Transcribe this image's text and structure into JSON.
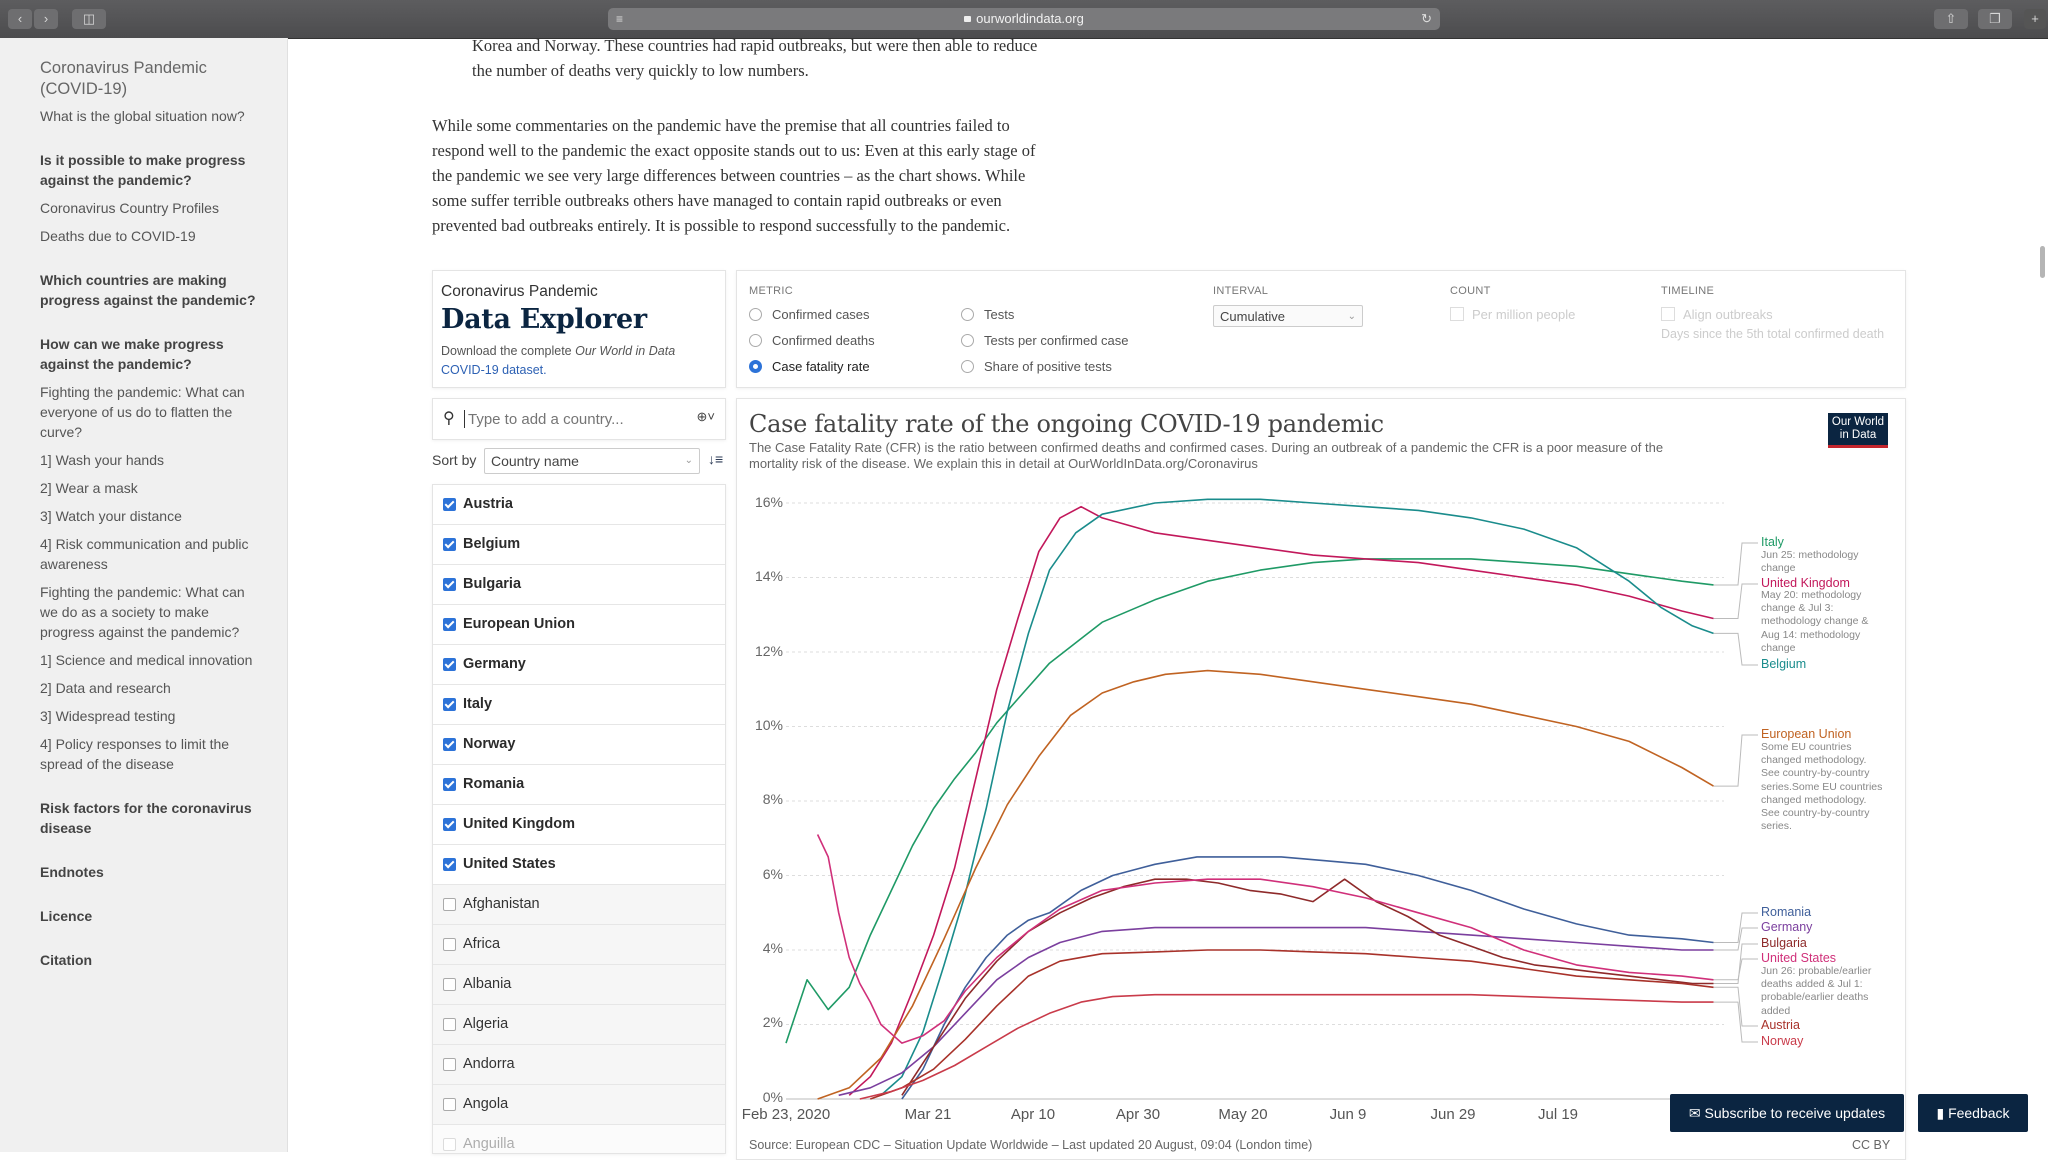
{
  "browser": {
    "url": "ourworldindata.org"
  },
  "sidebar": {
    "title": "Coronavirus Pandemic (COVID-19)",
    "items": [
      {
        "label": "What is the global situation now?",
        "bold": false
      },
      {
        "label": "Is it possible to make progress against the pandemic?",
        "bold": true
      },
      {
        "label": "Coronavirus Country Profiles",
        "bold": false
      },
      {
        "label": "Deaths due to COVID-19",
        "bold": false
      },
      {
        "label": "Which countries are making progress against the pandemic?",
        "bold": true
      },
      {
        "label": "How can we make progress against the pandemic?",
        "bold": true
      },
      {
        "label": "Fighting the pandemic: What can everyone of us do to flatten the curve?",
        "bold": false
      },
      {
        "label": "1] Wash your hands",
        "bold": false
      },
      {
        "label": "2] Wear a mask",
        "bold": false
      },
      {
        "label": "3] Watch your distance",
        "bold": false
      },
      {
        "label": "4] Risk communication and public awareness",
        "bold": false
      },
      {
        "label": "Fighting the pandemic: What can we do as a society to make progress against the pandemic?",
        "bold": false
      },
      {
        "label": "1] Science and medical innovation",
        "bold": false
      },
      {
        "label": "2] Data and research",
        "bold": false
      },
      {
        "label": "3] Widespread testing",
        "bold": false
      },
      {
        "label": "4] Policy responses to limit the spread of the disease",
        "bold": false
      },
      {
        "label": "Risk factors for the coronavirus disease",
        "bold": true
      },
      {
        "label": "Endnotes",
        "bold": true
      },
      {
        "label": "Licence",
        "bold": true
      },
      {
        "label": "Citation",
        "bold": true
      }
    ]
  },
  "article": {
    "intro_lines": [
      "Korea and Norway. These countries had rapid outbreaks, but were then able to reduce",
      "the number of deaths very quickly to low numbers."
    ],
    "paragraph_lines": [
      "While some commentaries on the pandemic have the premise that all countries failed to",
      "respond well to the pandemic the exact opposite stands out to us: Even at this early stage of",
      "the pandemic we see very large differences between countries – as the chart shows. While",
      "some suffer terrible outbreaks others have managed to contain rapid outbreaks or even",
      "prevented bad outbreaks entirely. It is possible to respond successfully to the pandemic."
    ]
  },
  "explorer": {
    "kicker": "Coronavirus Pandemic",
    "title": "Data Explorer",
    "download_prefix": "Download the complete ",
    "download_italic": "Our World in Data",
    "download_link": "COVID-19 dataset.",
    "search_placeholder": "Type to add a country...",
    "sort_by_label": "Sort by",
    "sort_value": "Country name",
    "countries": [
      {
        "name": "Austria",
        "selected": true
      },
      {
        "name": "Belgium",
        "selected": true
      },
      {
        "name": "Bulgaria",
        "selected": true
      },
      {
        "name": "European Union",
        "selected": true
      },
      {
        "name": "Germany",
        "selected": true
      },
      {
        "name": "Italy",
        "selected": true
      },
      {
        "name": "Norway",
        "selected": true
      },
      {
        "name": "Romania",
        "selected": true
      },
      {
        "name": "United Kingdom",
        "selected": true
      },
      {
        "name": "United States",
        "selected": true
      },
      {
        "name": "Afghanistan",
        "selected": false
      },
      {
        "name": "Africa",
        "selected": false
      },
      {
        "name": "Albania",
        "selected": false
      },
      {
        "name": "Algeria",
        "selected": false
      },
      {
        "name": "Andorra",
        "selected": false
      },
      {
        "name": "Angola",
        "selected": false
      },
      {
        "name": "Anguilla",
        "selected": false
      }
    ]
  },
  "controls": {
    "metric_heading": "METRIC",
    "metrics_col1": [
      "Confirmed cases",
      "Confirmed deaths",
      "Case fatality rate"
    ],
    "metrics_col2": [
      "Tests",
      "Tests per confirmed case",
      "Share of positive tests"
    ],
    "selected_metric": "Case fatality rate",
    "interval_heading": "INTERVAL",
    "interval_value": "Cumulative",
    "count_heading": "COUNT",
    "count_option": "Per million people",
    "timeline_heading": "TIMELINE",
    "timeline_option": "Align outbreaks",
    "timeline_note": "Days since the 5th total confirmed death"
  },
  "chart_header": {
    "logo_line1": "Our World",
    "logo_line2": "in Data",
    "source": "Source: European CDC – Situation Update Worldwide – Last updated 20 August, 09:04 (London time)",
    "license": "CC BY"
  },
  "chart_data": {
    "type": "line",
    "title": "Case fatality rate of the ongoing COVID-19 pandemic",
    "subtitle_lines": [
      "The Case Fatality Rate (CFR) is the ratio between confirmed deaths and confirmed cases. During an outbreak of a pandemic the CFR is a poor measure of the",
      "mortality risk of the disease. We explain this in detail at OurWorldInData.org/Coronavirus"
    ],
    "xlabel": "",
    "ylabel": "",
    "x_ticks": [
      "Feb 23, 2020",
      "Mar 21",
      "Apr 10",
      "Apr 30",
      "May 20",
      "Jun 9",
      "Jun 29",
      "Jul 19"
    ],
    "y_ticks": [
      "0%",
      "2%",
      "4%",
      "6%",
      "8%",
      "10%",
      "12%",
      "14%",
      "16%"
    ],
    "x_range_days": [
      0,
      178
    ],
    "ylim": [
      0,
      16
    ],
    "grid": true,
    "legend": "right-side labels",
    "series": [
      {
        "name": "Italy",
        "color": "#1f9a66",
        "x": [
          0,
          4,
          8,
          12,
          16,
          20,
          24,
          28,
          32,
          36,
          40,
          45,
          50,
          60,
          70,
          80,
          90,
          100,
          110,
          120,
          130,
          140,
          150,
          160,
          170,
          176
        ],
        "y": [
          1.5,
          3.2,
          2.4,
          3.0,
          4.4,
          5.6,
          6.8,
          7.8,
          8.6,
          9.3,
          10.1,
          10.9,
          11.7,
          12.8,
          13.4,
          13.9,
          14.2,
          14.4,
          14.5,
          14.5,
          14.5,
          14.4,
          14.3,
          14.1,
          13.9,
          13.8
        ]
      },
      {
        "name": "United Kingdom",
        "color": "#c2185b",
        "x": [
          12,
          16,
          20,
          24,
          28,
          32,
          36,
          40,
          44,
          48,
          52,
          56,
          60,
          70,
          80,
          90,
          100,
          110,
          120,
          130,
          140,
          150,
          160,
          170,
          176
        ],
        "y": [
          0.1,
          0.6,
          1.5,
          2.9,
          4.4,
          6.2,
          8.6,
          11.0,
          12.9,
          14.7,
          15.6,
          15.9,
          15.6,
          15.2,
          15.0,
          14.8,
          14.6,
          14.5,
          14.4,
          14.2,
          14.0,
          13.8,
          13.5,
          13.1,
          12.9
        ]
      },
      {
        "name": "Belgium",
        "color": "#1a8c8c",
        "x": [
          18,
          22,
          26,
          30,
          34,
          38,
          42,
          46,
          50,
          55,
          60,
          70,
          80,
          90,
          100,
          110,
          120,
          130,
          140,
          150,
          160,
          166,
          172,
          176
        ],
        "y": [
          0.1,
          0.6,
          1.8,
          3.6,
          5.5,
          7.8,
          10.4,
          12.5,
          14.2,
          15.2,
          15.7,
          16.0,
          16.1,
          16.1,
          16.0,
          15.9,
          15.8,
          15.6,
          15.3,
          14.8,
          13.9,
          13.2,
          12.7,
          12.5
        ]
      },
      {
        "name": "European Union",
        "color": "#c06322",
        "x": [
          6,
          12,
          18,
          24,
          30,
          36,
          42,
          48,
          54,
          60,
          66,
          72,
          80,
          90,
          100,
          110,
          120,
          130,
          140,
          150,
          160,
          170,
          176
        ],
        "y": [
          0.0,
          0.3,
          1.1,
          2.5,
          4.3,
          6.2,
          7.9,
          9.2,
          10.3,
          10.9,
          11.2,
          11.4,
          11.5,
          11.4,
          11.2,
          11.0,
          10.8,
          10.6,
          10.3,
          10.0,
          9.6,
          8.9,
          8.4
        ]
      },
      {
        "name": "Romania",
        "color": "#3f5f9a",
        "x": [
          22,
          26,
          30,
          34,
          38,
          42,
          46,
          50,
          56,
          62,
          70,
          78,
          86,
          94,
          102,
          110,
          120,
          130,
          140,
          150,
          160,
          170,
          176
        ],
        "y": [
          0.0,
          0.8,
          2.0,
          3.0,
          3.8,
          4.4,
          4.8,
          5.0,
          5.6,
          6.0,
          6.3,
          6.5,
          6.5,
          6.5,
          6.4,
          6.3,
          6.0,
          5.6,
          5.1,
          4.7,
          4.4,
          4.3,
          4.2
        ]
      },
      {
        "name": "Germany",
        "color": "#7b3f9e",
        "x": [
          10,
          16,
          22,
          28,
          34,
          40,
          46,
          52,
          60,
          70,
          80,
          90,
          100,
          110,
          120,
          130,
          140,
          150,
          160,
          170,
          176
        ],
        "y": [
          0.1,
          0.3,
          0.7,
          1.4,
          2.3,
          3.2,
          3.8,
          4.2,
          4.5,
          4.6,
          4.6,
          4.6,
          4.6,
          4.6,
          4.5,
          4.4,
          4.3,
          4.2,
          4.1,
          4.0,
          4.0
        ]
      },
      {
        "name": "Bulgaria",
        "color": "#8e2a2a",
        "x": [
          22,
          28,
          34,
          40,
          46,
          52,
          58,
          64,
          70,
          76,
          82,
          88,
          94,
          100,
          106,
          112,
          118,
          124,
          130,
          136,
          142,
          148,
          154,
          160,
          166,
          172,
          176
        ],
        "y": [
          0.1,
          1.4,
          2.7,
          3.7,
          4.5,
          5.0,
          5.4,
          5.7,
          5.9,
          5.9,
          5.8,
          5.6,
          5.5,
          5.3,
          5.9,
          5.3,
          4.9,
          4.4,
          4.1,
          3.8,
          3.6,
          3.5,
          3.4,
          3.3,
          3.2,
          3.1,
          3.1
        ]
      },
      {
        "name": "United States",
        "color": "#d0307a",
        "x": [
          6,
          8,
          10,
          12,
          14,
          16,
          18,
          22,
          26,
          30,
          34,
          40,
          46,
          52,
          60,
          70,
          80,
          90,
          100,
          110,
          120,
          130,
          140,
          150,
          160,
          170,
          176
        ],
        "y": [
          7.1,
          6.5,
          5.0,
          3.8,
          3.1,
          2.6,
          2.0,
          1.5,
          1.7,
          2.1,
          2.9,
          3.8,
          4.5,
          5.1,
          5.6,
          5.8,
          5.9,
          5.9,
          5.7,
          5.4,
          5.0,
          4.6,
          4.0,
          3.6,
          3.4,
          3.3,
          3.2
        ]
      },
      {
        "name": "Austria",
        "color": "#a8322a",
        "x": [
          16,
          22,
          28,
          34,
          40,
          46,
          52,
          60,
          70,
          80,
          90,
          100,
          110,
          120,
          130,
          140,
          150,
          160,
          170,
          176
        ],
        "y": [
          0.0,
          0.3,
          0.8,
          1.6,
          2.5,
          3.3,
          3.7,
          3.9,
          3.95,
          4.0,
          4.0,
          3.95,
          3.9,
          3.8,
          3.7,
          3.5,
          3.3,
          3.2,
          3.1,
          3.0
        ]
      },
      {
        "name": "Norway",
        "color": "#c93b4a",
        "x": [
          14,
          20,
          26,
          32,
          38,
          44,
          50,
          56,
          62,
          70,
          80,
          90,
          100,
          110,
          120,
          130,
          140,
          150,
          160,
          170,
          176
        ],
        "y": [
          0.0,
          0.2,
          0.5,
          0.9,
          1.4,
          1.9,
          2.3,
          2.6,
          2.75,
          2.8,
          2.8,
          2.8,
          2.8,
          2.8,
          2.8,
          2.8,
          2.75,
          2.7,
          2.65,
          2.6,
          2.6
        ]
      }
    ],
    "series_notes": {
      "Italy": "Jun 25: methodology change",
      "United Kingdom": "May 20: methodology change & Jul 3: methodology change & Aug 14: methodology change",
      "European Union": "Some EU countries changed methodology. See country-by-country series.Some EU countries changed methodology. See country-by-country series.",
      "United States": "Jun 26: probable/earlier deaths added & Jul 1: probable/earlier deaths added"
    }
  },
  "buttons": {
    "subscribe": "Subscribe to receive updates",
    "feedback": "Feedback"
  }
}
